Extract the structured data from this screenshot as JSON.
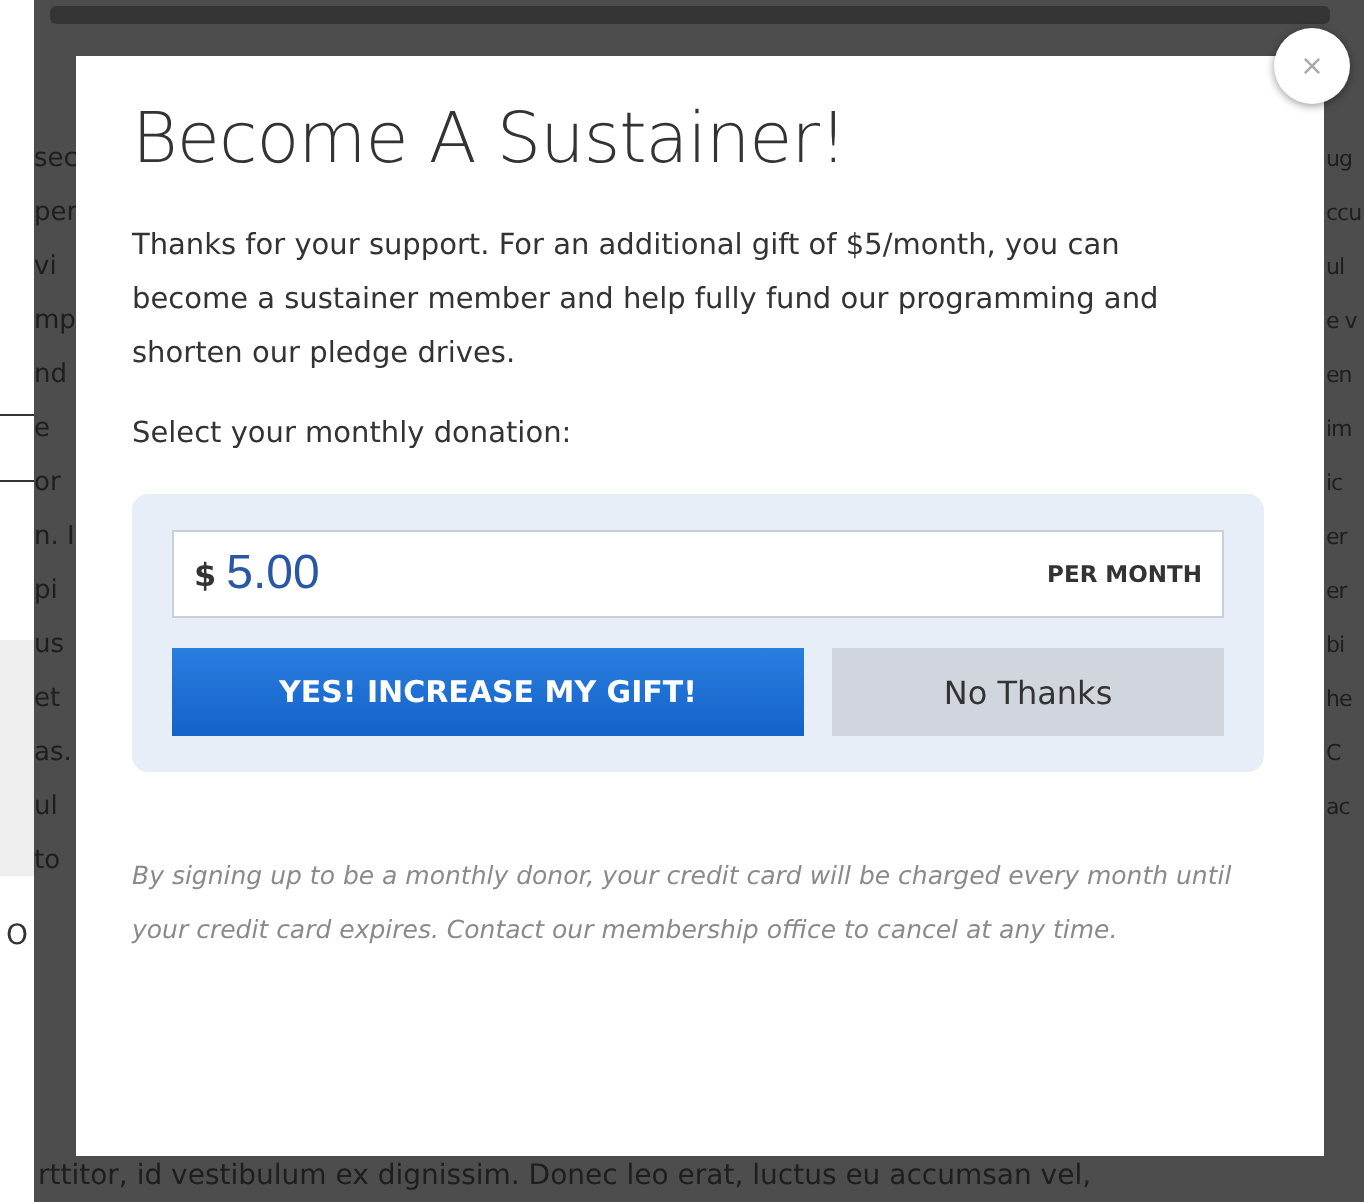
{
  "background": {
    "left_fragments": [
      "sec",
      "per",
      "vi",
      "mp",
      "nd",
      "e",
      "or",
      "n. I",
      "pi",
      "us",
      "et",
      "as.",
      "ul",
      "to"
    ],
    "right_fragments": [
      "ug",
      "ccu",
      "ul",
      "e v",
      "en",
      "im",
      "ic",
      "er",
      "er",
      "bi",
      "he",
      "C",
      "ac"
    ],
    "side_panel_text": "O",
    "bottom_text": "rttitor, id vestibulum ex dignissim. Donec leo erat, luctus eu accumsan vel,"
  },
  "modal": {
    "close": "×",
    "title": "Become A Sustainer!",
    "intro": "Thanks for your support. For an additional gift of $5/month, you can become a sustainer member and help fully fund our programming and shorten our pledge drives.",
    "prompt": "Select your monthly donation:",
    "amount": {
      "currency": "$",
      "value": "5.00",
      "suffix": "PER MONTH"
    },
    "buttons": [
      {
        "kind": "primary",
        "label": "YES! INCREASE MY GIFT!"
      },
      {
        "kind": "secondary",
        "label": "No Thanks"
      }
    ],
    "disclaimer": "By signing up to be a monthly donor, your credit card will be charged every month until your credit card expires. Contact our membership office to cancel at any time."
  }
}
